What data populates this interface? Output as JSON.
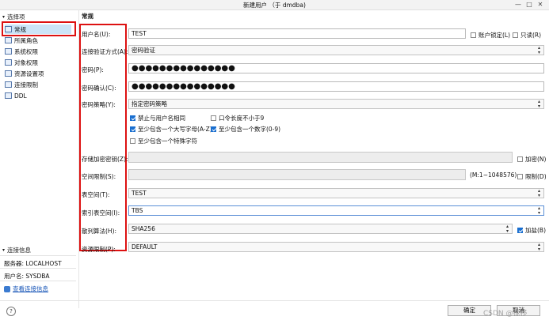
{
  "window": {
    "title": "新建用户 （于 dmdba)",
    "min": "—",
    "max": "□",
    "close": "✕"
  },
  "tree": {
    "header": "选择项",
    "items": [
      {
        "label": "常规",
        "selected": true
      },
      {
        "label": "所属角色"
      },
      {
        "label": "系统权限"
      },
      {
        "label": "对象权限"
      },
      {
        "label": "资源设置项"
      },
      {
        "label": "连接限制"
      },
      {
        "label": "DDL"
      }
    ]
  },
  "conn": {
    "header": "连接信息",
    "server": "服务器: LOCALHOST",
    "user": "用户名: SYSDBA",
    "view_link": "查看连接信息"
  },
  "section_title": "常规",
  "form": {
    "username_label": "用户名(U):",
    "username_value": "TEST",
    "lock_label": "账户锁定(L)",
    "readonly_label": "只读(R)",
    "auth_label": "连接验证方式(A):",
    "auth_value": "密码验证",
    "pwd_label": "密码(P):",
    "pwd_value": "●●●●●●●●●●●●●●●",
    "pwd_confirm_label": "密码确认(C):",
    "pwd_confirm_value": "●●●●●●●●●●●●●●●",
    "policy_label": "密码策略(Y):",
    "policy_value": "指定密码策略",
    "policy_options": [
      {
        "label": "禁止与用户名相同",
        "checked": true
      },
      {
        "label": "口令长度不小于9",
        "checked": false
      },
      {
        "label": "至少包含一个大写字母(A-Z)",
        "checked": true
      },
      {
        "label": "至少包含一个数字(0-9)",
        "checked": true
      },
      {
        "label": "至少包含一个特殊字符",
        "checked": false
      }
    ],
    "enc_key_label": "存储加密密钥(Z):",
    "encrypt_label": "加密(N)",
    "space_limit_label": "空间限制(S):",
    "space_limit_range": "(M:1~1048576)",
    "space_limit_check": "限制(D)",
    "tablespace_label": "表空间(T):",
    "tablespace_value": "TEST",
    "index_ts_label": "索引表空间(I):",
    "index_ts_value": "TBS",
    "hash_label": "散列算法(H):",
    "hash_value": "SHA256",
    "salt_label": "加盐(B)",
    "resource_label": "资源限制(P):",
    "resource_value": "DEFAULT"
  },
  "footer": {
    "help": "?",
    "ok": "确定",
    "cancel": "取消",
    "watermark": "CSDN @橡移"
  }
}
